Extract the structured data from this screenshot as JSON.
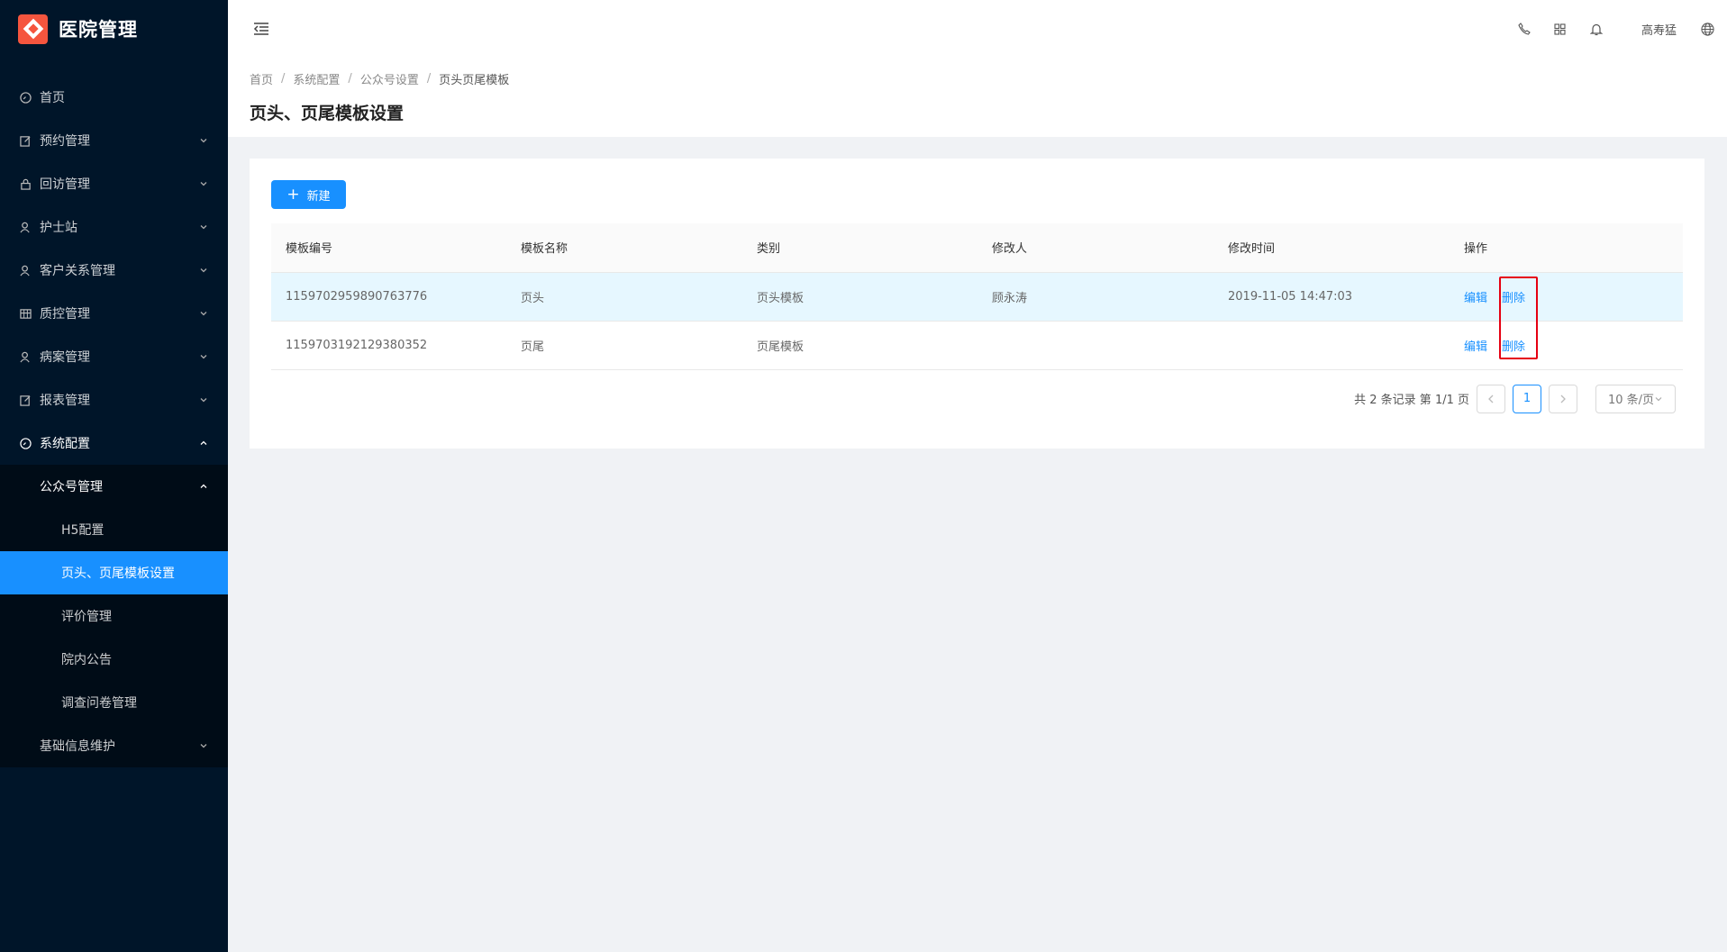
{
  "app": {
    "title": "医院管理",
    "brand_color": "#f5553e",
    "accent": "#1890ff"
  },
  "sidebar": {
    "items": [
      {
        "label": "首页",
        "icon": "dashboard-icon"
      },
      {
        "label": "预约管理",
        "icon": "edit-icon"
      },
      {
        "label": "回访管理",
        "icon": "lock-icon"
      },
      {
        "label": "护士站",
        "icon": "user-icon"
      },
      {
        "label": "客户关系管理",
        "icon": "user-icon"
      },
      {
        "label": "质控管理",
        "icon": "table-icon"
      },
      {
        "label": "病案管理",
        "icon": "user-icon"
      },
      {
        "label": "报表管理",
        "icon": "edit-icon"
      },
      {
        "label": "系统配置",
        "icon": "dashboard-icon"
      }
    ],
    "submenu": {
      "label": "公众号管理",
      "children": [
        "H5配置",
        "页头、页尾模板设置",
        "评价管理",
        "院内公告",
        "调查问卷管理"
      ]
    },
    "basic_info": "基础信息维护"
  },
  "header": {
    "username": "高寿猛"
  },
  "breadcrumb": [
    "首页",
    "系统配置",
    "公众号设置",
    "页头页尾模板"
  ],
  "page_title": "页头、页尾模板设置",
  "toolbar": {
    "new_label": "新建"
  },
  "table": {
    "columns": [
      "模板编号",
      "模板名称",
      "类别",
      "修改人",
      "修改时间",
      "操作"
    ],
    "rows": [
      {
        "id": "1159702959890763776",
        "name": "页头",
        "type": "页头模板",
        "modifier": "顾永涛",
        "time": "2019-11-05 14:47:03",
        "edit": "编辑",
        "delete": "删除"
      },
      {
        "id": "1159703192129380352",
        "name": "页尾",
        "type": "页尾模板",
        "modifier": "",
        "time": "",
        "edit": "编辑",
        "delete": "删除"
      }
    ]
  },
  "pagination": {
    "summary": "共 2 条记录 第 1/1 页",
    "current": "1",
    "page_size": "10 条/页"
  }
}
